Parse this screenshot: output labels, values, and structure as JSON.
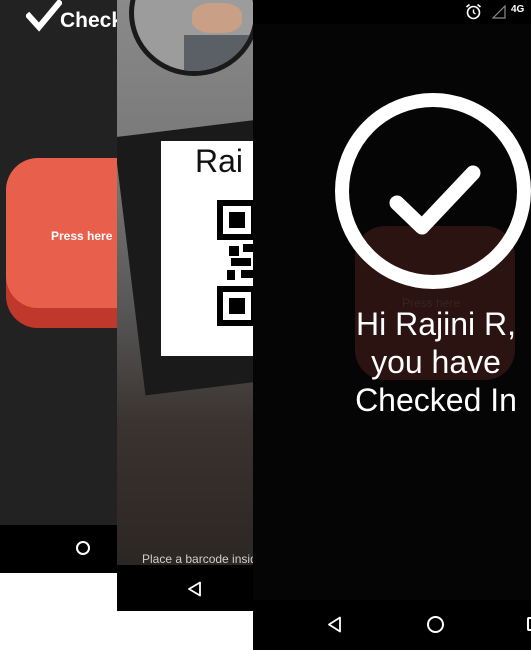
{
  "screen1": {
    "app_title": "Check",
    "press_button_label": "Press here",
    "colors": {
      "background": "#222222",
      "button": "#e8604c",
      "button_shadow": "#c0382b"
    }
  },
  "screen2": {
    "badge_name": "Rai",
    "hint_text": "Place a barcode inside",
    "colors": {
      "card": "#ffffff",
      "badge_frame": "#1a1a1a"
    }
  },
  "screen3": {
    "status_bar": {
      "network": "4G",
      "icons": [
        "alarm-icon",
        "signal-icon"
      ]
    },
    "background_button_label": "Press here",
    "message": "Hi Rajini R, you have Checked In",
    "colors": {
      "background": "#000000",
      "text": "#ffffff",
      "faded_button": "#2a1310"
    }
  }
}
